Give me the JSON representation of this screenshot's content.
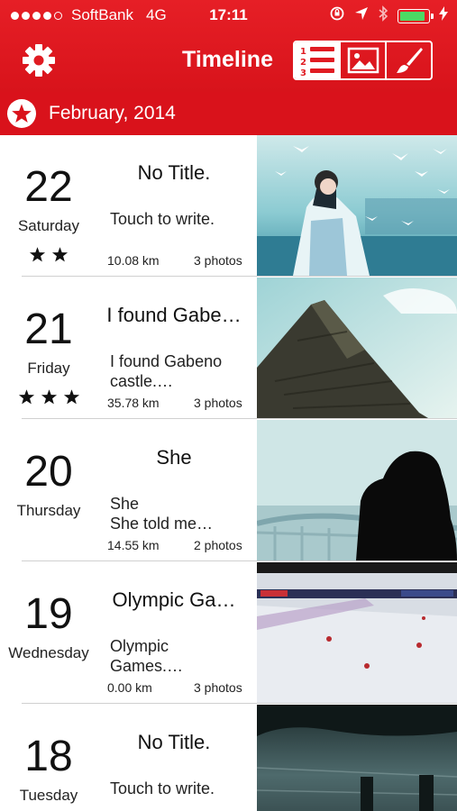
{
  "status_bar": {
    "carrier": "SoftBank",
    "network": "4G",
    "time": "17:11"
  },
  "nav": {
    "title": "Timeline",
    "left_icon": "gear-icon",
    "segments": [
      {
        "icon": "numbered-list-icon",
        "active": true
      },
      {
        "icon": "picture-icon",
        "active": false
      },
      {
        "icon": "brush-icon",
        "active": false
      }
    ]
  },
  "month_bar": {
    "label": "February, 2014",
    "icon": "star-badge-icon"
  },
  "entries": [
    {
      "day": "22",
      "weekday": "Saturday",
      "stars": 2,
      "title": "No Title.",
      "body": "Touch to write.",
      "distance": "10.08 km",
      "photos": "3 photos"
    },
    {
      "day": "21",
      "weekday": "Friday",
      "stars": 3,
      "title": "I found Gabe…",
      "body": "I found Gabeno\ncastle.…",
      "distance": "35.78 km",
      "photos": "3 photos"
    },
    {
      "day": "20",
      "weekday": "Thursday",
      "stars": 0,
      "title": "She",
      "body": "She\nShe told me…",
      "distance": "14.55 km",
      "photos": "2 photos"
    },
    {
      "day": "19",
      "weekday": "Wednesday",
      "stars": 0,
      "title": "Olympic Ga…",
      "body": "Olympic\nGames.…",
      "distance": "0.00 km",
      "photos": "3 photos"
    },
    {
      "day": "18",
      "weekday": "Tuesday",
      "stars": 0,
      "title": "No Title.",
      "body": "Touch to write.",
      "distance": "",
      "photos": ""
    }
  ],
  "colors": {
    "header_red": "#e61f26",
    "month_red": "#d9121b"
  }
}
